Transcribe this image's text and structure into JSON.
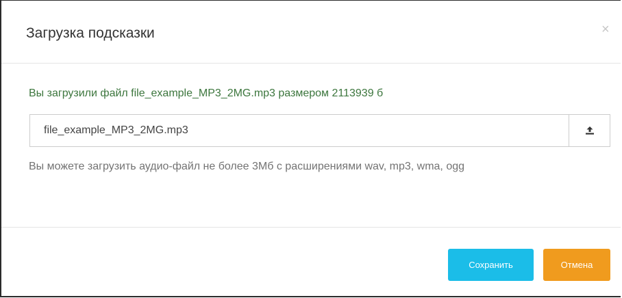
{
  "modal": {
    "title": "Загрузка подсказки",
    "close_glyph": "×"
  },
  "body": {
    "success_message": "Вы загрузили файл file_example_MP3_2MG.mp3 размером 2113939 б",
    "file_input_value": "file_example_MP3_2MG.mp3",
    "upload_icon": "upload-icon",
    "help_text": "Вы можете загрузить аудио-файл не более 3Мб с расширениями wav, mp3, wma, ogg"
  },
  "footer": {
    "save_label": "Сохранить",
    "cancel_label": "Отмена"
  },
  "colors": {
    "success_text": "#3c763d",
    "save_button": "#1bbde8",
    "cancel_button": "#f09b1e"
  }
}
